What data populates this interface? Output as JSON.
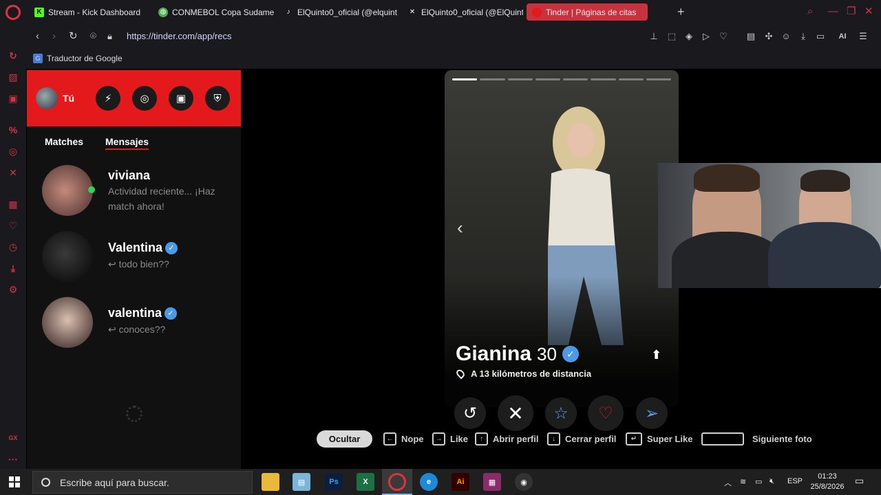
{
  "browser": {
    "tabs": [
      {
        "label": "Stream - Kick Dashboard",
        "icon": "kick-icon",
        "color": "#53fc18"
      },
      {
        "label": "CONMEBOL Copa Sudame",
        "icon": "globe-icon",
        "color": "#4caf50"
      },
      {
        "label": "ElQuinto0_oficial (@elquint",
        "icon": "tiktok-icon",
        "color": "#ffffff"
      },
      {
        "label": "ElQuinto0_oficial (@ElQuint",
        "icon": "x-icon",
        "color": "#ffffff"
      },
      {
        "label": "Tinder | Páginas de citas",
        "icon": "tinder-icon",
        "color": "#c8323f"
      }
    ],
    "new_tab": "+",
    "url": "https://tinder.com/app/recs",
    "bookmark": "Traductor de Google",
    "ai_label": "AI"
  },
  "tinder": {
    "me_label": "Tú",
    "tabs": {
      "matches": "Matches",
      "messages": "Mensajes"
    },
    "conversations": [
      {
        "name": "viviana",
        "preview_line1": "Actividad reciente... ¡Haz",
        "preview_line2": "match ahora!",
        "verified": false,
        "online": true
      },
      {
        "name": "Valentina",
        "preview_line1": "↩ todo bien??",
        "verified": true
      },
      {
        "name": "valentina",
        "preview_line1": "↩ conoces??",
        "verified": true
      }
    ],
    "profile": {
      "name": "Gianina",
      "age": "30",
      "distance": "A 13 kilómetros de distancia",
      "photo_count": 8,
      "current_photo": 1
    },
    "hints": {
      "hide": "Ocultar",
      "nope": "Nope",
      "like": "Like",
      "open_profile": "Abrir perfil",
      "close_profile": "Cerrar perfil",
      "super_like": "Super Like",
      "next_photo": "Siguiente foto"
    },
    "accent": "#e3191c"
  },
  "taskbar": {
    "search_placeholder": "Escribe aquí para buscar.",
    "language": "ESP",
    "time": "01:23",
    "date": "25/8/2026"
  }
}
